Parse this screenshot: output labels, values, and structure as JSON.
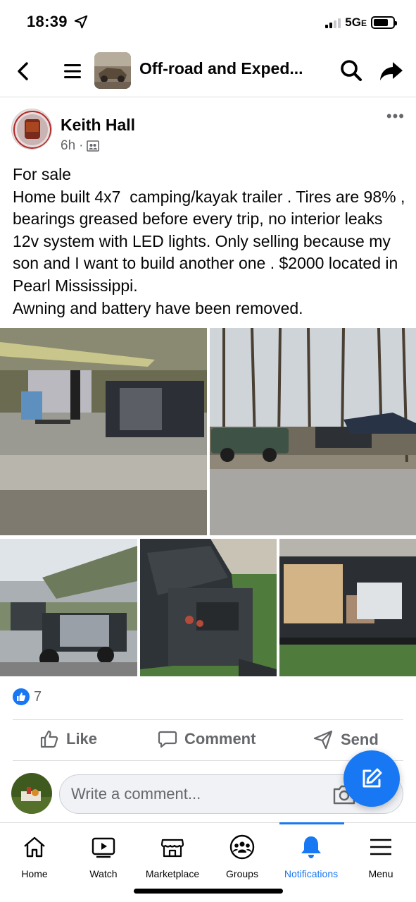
{
  "status": {
    "time": "18:39",
    "network": "5G",
    "network_suffix": "E"
  },
  "nav": {
    "title": "Off-road and Exped..."
  },
  "post": {
    "author": "Keith Hall",
    "time": "6h",
    "text": "For sale\nHome built 4x7  camping/kayak trailer . Tires are 98% , bearings greased before every trip, no interior leaks 12v system with LED lights. Only selling because my son and I want to build another one . $2000 located in Pearl Mississippi.\nAwning and battery have been removed.",
    "reaction_count": "7"
  },
  "actions": {
    "like": "Like",
    "comment": "Comment",
    "send": "Send"
  },
  "composer": {
    "placeholder": "Write a comment..."
  },
  "tabs": [
    {
      "label": "Home",
      "icon": "home-icon"
    },
    {
      "label": "Watch",
      "icon": "watch-icon"
    },
    {
      "label": "Marketplace",
      "icon": "marketplace-icon"
    },
    {
      "label": "Groups",
      "icon": "groups-icon"
    },
    {
      "label": "Notifications",
      "icon": "bell-icon",
      "active": true
    },
    {
      "label": "Menu",
      "icon": "menu-icon"
    }
  ],
  "colors": {
    "accent": "#1877f2",
    "secondary_text": "#65676b"
  }
}
